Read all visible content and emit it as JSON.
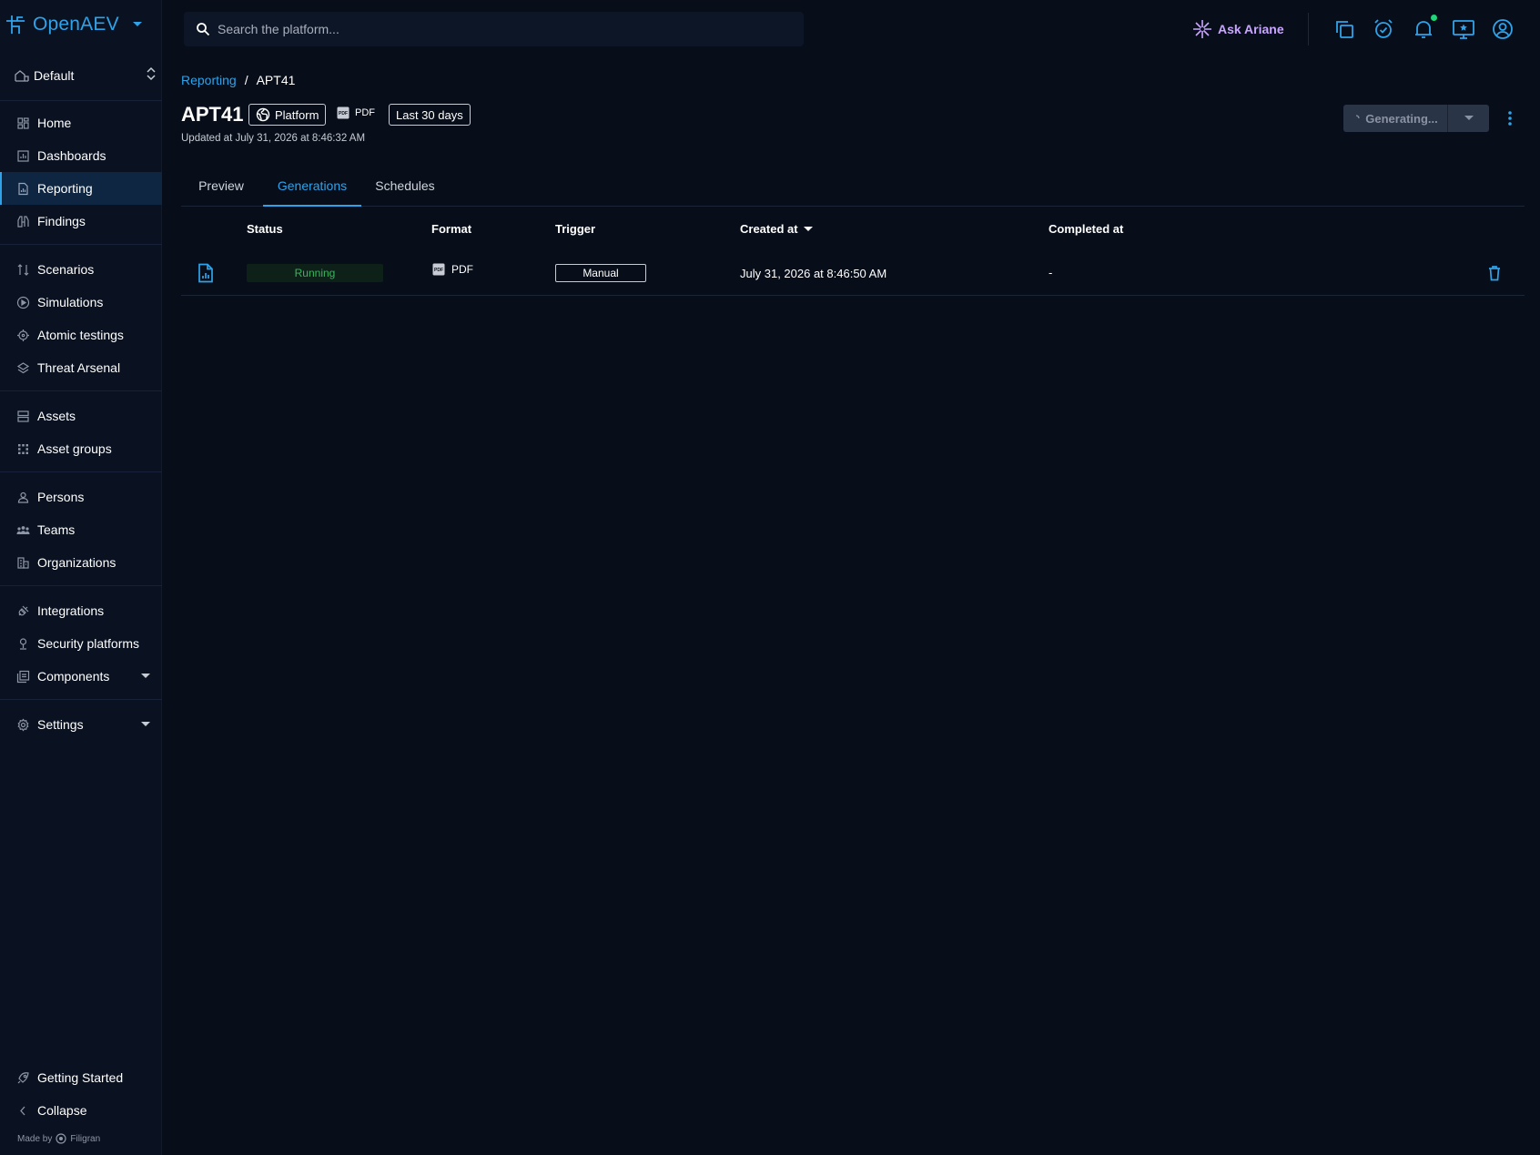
{
  "app": {
    "name": "OpenAEV",
    "brand_color": "#2fa3ea"
  },
  "workspace": {
    "label": "Default"
  },
  "sidebar": {
    "items": [
      {
        "label": "Home",
        "icon": "home-icon"
      },
      {
        "label": "Dashboards",
        "icon": "dashboards-icon"
      },
      {
        "label": "Reporting",
        "icon": "reporting-icon",
        "active": true
      },
      {
        "label": "Findings",
        "icon": "findings-icon"
      },
      {
        "label": "Scenarios",
        "icon": "scenarios-icon"
      },
      {
        "label": "Simulations",
        "icon": "simulations-icon"
      },
      {
        "label": "Atomic testings",
        "icon": "atomic-testings-icon"
      },
      {
        "label": "Threat Arsenal",
        "icon": "threat-arsenal-icon"
      },
      {
        "label": "Assets",
        "icon": "assets-icon"
      },
      {
        "label": "Asset groups",
        "icon": "asset-groups-icon"
      },
      {
        "label": "Persons",
        "icon": "persons-icon"
      },
      {
        "label": "Teams",
        "icon": "teams-icon"
      },
      {
        "label": "Organizations",
        "icon": "organizations-icon"
      },
      {
        "label": "Integrations",
        "icon": "integrations-icon"
      },
      {
        "label": "Security platforms",
        "icon": "security-platforms-icon"
      },
      {
        "label": "Components",
        "icon": "components-icon",
        "expandable": true
      },
      {
        "label": "Settings",
        "icon": "settings-icon",
        "expandable": true
      }
    ],
    "footer": [
      {
        "label": "Getting Started",
        "icon": "rocket-icon"
      },
      {
        "label": "Collapse",
        "icon": "chevron-left-icon"
      }
    ],
    "made_by": {
      "prefix": "Made by",
      "company": "Filigran"
    }
  },
  "topbar": {
    "search_placeholder": "Search the platform...",
    "ask_ariane": "Ask Ariane",
    "ariane_color": "#c9a6ff",
    "icons": [
      "copy-icon",
      "alarm-icon",
      "bell-icon",
      "screen-star-icon",
      "account-icon"
    ],
    "notification_dot_color": "#1fd67a"
  },
  "breadcrumb": {
    "parent": "Reporting",
    "separator": "/",
    "current": "APT41"
  },
  "report": {
    "title": "APT41",
    "scope_chip": "Platform",
    "format": "PDF",
    "period_chip": "Last 30 days",
    "updated": "Updated at July 31, 2026 at 8:46:32 AM",
    "generate_button": "Generating..."
  },
  "tabs": [
    {
      "label": "Preview"
    },
    {
      "label": "Generations",
      "active": true
    },
    {
      "label": "Schedules"
    }
  ],
  "table": {
    "columns": {
      "status": "Status",
      "format": "Format",
      "trigger": "Trigger",
      "created_at": "Created at",
      "completed_at": "Completed at"
    },
    "rows": [
      {
        "status": "Running",
        "format": "PDF",
        "trigger": "Manual",
        "created_at": "July 31, 2026 at 8:46:50 AM",
        "completed_at": "-"
      }
    ],
    "running_color": "#3cb35f"
  }
}
